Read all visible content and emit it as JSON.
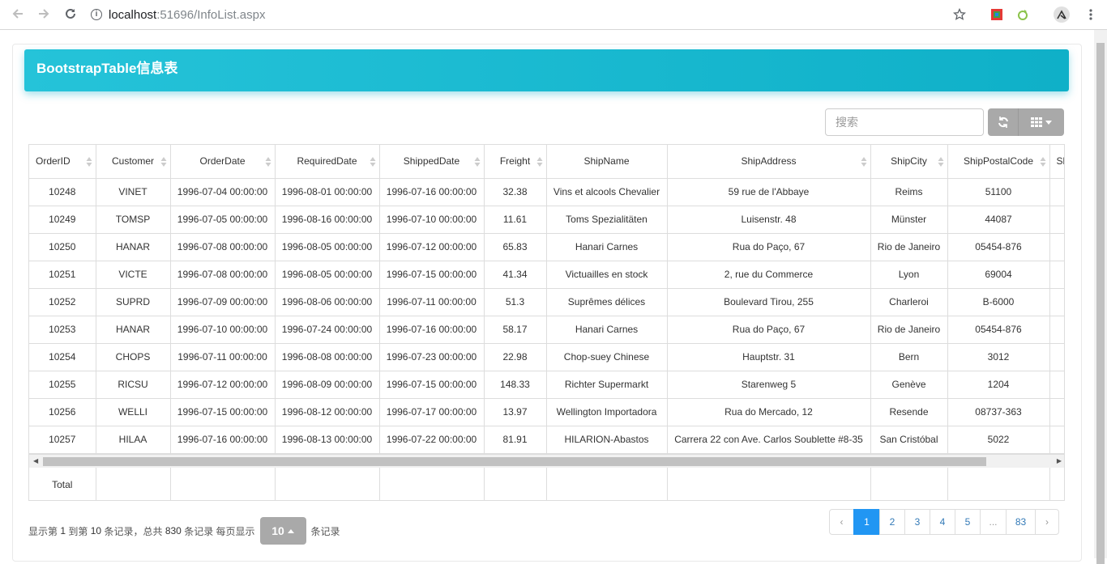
{
  "browser": {
    "back_icon": "arrow-left-icon",
    "forward_icon": "arrow-right-icon",
    "reload_icon": "reload-icon",
    "url_host": "localhost",
    "url_rest": ":51696/InfoList.aspx"
  },
  "panel": {
    "title": "BootstrapTable信息表"
  },
  "toolbar": {
    "search_placeholder": "搜索"
  },
  "table": {
    "columns": [
      "OrderID",
      "Customer",
      "OrderDate",
      "RequiredDate",
      "ShippedDate",
      "Freight",
      "ShipName",
      "ShipAddress",
      "ShipCity",
      "ShipPostalCode",
      "Sh"
    ],
    "rows": [
      [
        "10248",
        "VINET",
        "1996-07-04 00:00:00",
        "1996-08-01 00:00:00",
        "1996-07-16 00:00:00",
        "32.38",
        "Vins et alcools Chevalier",
        "59 rue de l'Abbaye",
        "Reims",
        "51100"
      ],
      [
        "10249",
        "TOMSP",
        "1996-07-05 00:00:00",
        "1996-08-16 00:00:00",
        "1996-07-10 00:00:00",
        "11.61",
        "Toms Spezialitäten",
        "Luisenstr. 48",
        "Münster",
        "44087"
      ],
      [
        "10250",
        "HANAR",
        "1996-07-08 00:00:00",
        "1996-08-05 00:00:00",
        "1996-07-12 00:00:00",
        "65.83",
        "Hanari Carnes",
        "Rua do Paço, 67",
        "Rio de Janeiro",
        "05454-876"
      ],
      [
        "10251",
        "VICTE",
        "1996-07-08 00:00:00",
        "1996-08-05 00:00:00",
        "1996-07-15 00:00:00",
        "41.34",
        "Victuailles en stock",
        "2, rue du Commerce",
        "Lyon",
        "69004"
      ],
      [
        "10252",
        "SUPRD",
        "1996-07-09 00:00:00",
        "1996-08-06 00:00:00",
        "1996-07-11 00:00:00",
        "51.3",
        "Suprêmes délices",
        "Boulevard Tirou, 255",
        "Charleroi",
        "B-6000"
      ],
      [
        "10253",
        "HANAR",
        "1996-07-10 00:00:00",
        "1996-07-24 00:00:00",
        "1996-07-16 00:00:00",
        "58.17",
        "Hanari Carnes",
        "Rua do Paço, 67",
        "Rio de Janeiro",
        "05454-876"
      ],
      [
        "10254",
        "CHOPS",
        "1996-07-11 00:00:00",
        "1996-08-08 00:00:00",
        "1996-07-23 00:00:00",
        "22.98",
        "Chop-suey Chinese",
        "Hauptstr. 31",
        "Bern",
        "3012"
      ],
      [
        "10255",
        "RICSU",
        "1996-07-12 00:00:00",
        "1996-08-09 00:00:00",
        "1996-07-15 00:00:00",
        "148.33",
        "Richter Supermarkt",
        "Starenweg 5",
        "Genève",
        "1204"
      ],
      [
        "10256",
        "WELLI",
        "1996-07-15 00:00:00",
        "1996-08-12 00:00:00",
        "1996-07-17 00:00:00",
        "13.97",
        "Wellington Importadora",
        "Rua do Mercado, 12",
        "Resende",
        "08737-363"
      ],
      [
        "10257",
        "HILAA",
        "1996-07-16 00:00:00",
        "1996-08-13 00:00:00",
        "1996-07-22 00:00:00",
        "81.91",
        "HILARION-Abastos",
        "Carrera 22 con Ave. Carlos Soublette #8-35",
        "San Cristóbal",
        "5022"
      ]
    ],
    "footer_label": "Total"
  },
  "pagination": {
    "info_prefix": "显示第",
    "from": "1",
    "info_mid1": "到第",
    "to": "10",
    "info_mid2": "条记录，总共",
    "total": "830",
    "info_mid3": "条记录 每页显示",
    "page_size": "10",
    "info_suffix": "条记录",
    "pages": [
      "‹",
      "1",
      "2",
      "3",
      "4",
      "5",
      "...",
      "83",
      "›"
    ],
    "active_page": "1"
  }
}
